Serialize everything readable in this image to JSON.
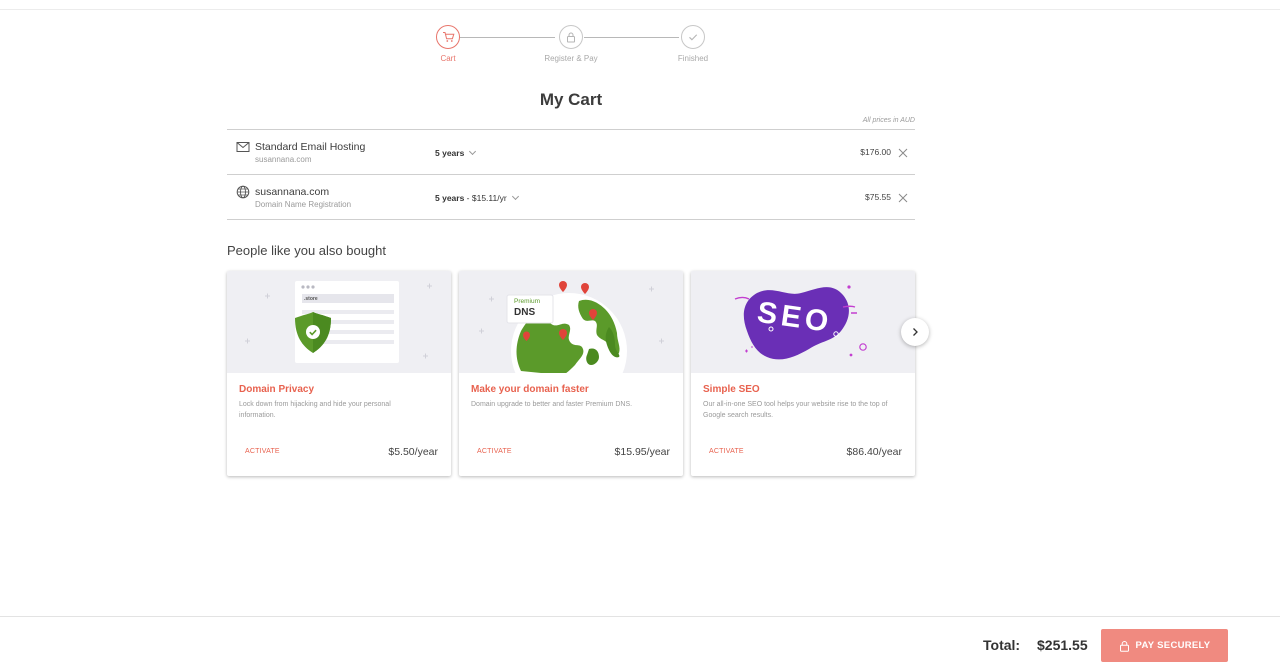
{
  "stepper": {
    "steps": [
      {
        "label": "Cart",
        "icon": "cart-icon"
      },
      {
        "label": "Register & Pay",
        "icon": "lock-icon"
      },
      {
        "label": "Finished",
        "icon": "check-icon"
      }
    ],
    "active_color": "#e8756b"
  },
  "page": {
    "title": "My Cart",
    "price_note": "All prices in AUD"
  },
  "cart": {
    "items": [
      {
        "name": "Standard Email Hosting",
        "sub": "susannana.com",
        "term": "5 years",
        "term_extra": "",
        "price": "$176.00",
        "icon": "envelope-icon"
      },
      {
        "name": "susannana.com",
        "sub": "Domain Name Registration",
        "term": "5 years",
        "term_extra": " - $15.11/yr",
        "price": "$75.55",
        "icon": "globe-icon"
      }
    ]
  },
  "upsell": {
    "heading": "People like you also bought",
    "cards": [
      {
        "title": "Domain Privacy",
        "desc": "Lock down from hijacking and hide your personal information.",
        "action": "ACTIVATE",
        "price": "$5.50/year",
        "art_tag": ".store"
      },
      {
        "title": "Make your domain faster",
        "desc": "Domain upgrade to better and faster Premium DNS.",
        "action": "ACTIVATE",
        "price": "$15.95/year",
        "art_tag_small": "Premium",
        "art_tag": "DNS"
      },
      {
        "title": "Simple SEO",
        "desc": "Our all-in-one SEO tool helps your website rise to the top of Google search results.",
        "action": "ACTIVATE",
        "price": "$86.40/year",
        "art_tag": "SEO"
      }
    ]
  },
  "footer": {
    "total_label": "Total:",
    "total_value": "$251.55",
    "pay_label": "PAY SECURELY",
    "pay_color": "#f08a80"
  }
}
